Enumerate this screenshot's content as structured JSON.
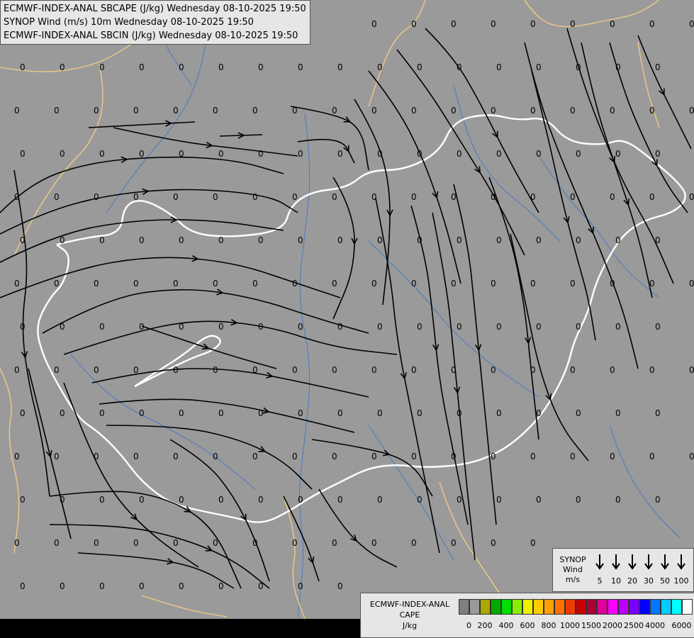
{
  "titles": {
    "line1": "ECMWF-INDEX-ANAL SBCAPE (J/kg) Wednesday 08-10-2025 19:50",
    "line2": "SYNOP Wind (m/s) 10m Wednesday 08-10-2025 19:50",
    "line3": "ECMWF-INDEX-ANAL SBCIN (J/kg) Wednesday 08-10-2025 19:50"
  },
  "map": {
    "background_color": "#9a9a9a",
    "border_country_color": "#ffffff",
    "border_neighbor_color": "#e7c48a",
    "river_color": "#4a78c0",
    "streamline_color": "#000000",
    "value_label": "0"
  },
  "synop_legend": {
    "title_line1": "SYNOP",
    "title_line2": "Wind",
    "title_line3": "m/s",
    "speeds": [
      "5",
      "10",
      "20",
      "30",
      "50",
      "100"
    ]
  },
  "cape_legend": {
    "title_line1": "ECMWF-INDEX-ANAL",
    "title_line2": "CAPE",
    "title_line3": "J/kg",
    "colors": [
      "#7f7f7f",
      "#9a9a9a",
      "#a8a800",
      "#00aa00",
      "#00dd00",
      "#88ee00",
      "#eeee00",
      "#ffcc00",
      "#ffa000",
      "#ff7000",
      "#ee3a00",
      "#cc0000",
      "#aa0033",
      "#dd0099",
      "#ff00ff",
      "#bb00ff",
      "#7700ff",
      "#0000ff",
      "#0077ff",
      "#00ccff",
      "#00ffff",
      "#ffffff"
    ],
    "ticks": [
      "0",
      "200",
      "400",
      "600",
      "800",
      "1000",
      "1500",
      "2000",
      "2500",
      "4000",
      "6000"
    ]
  }
}
